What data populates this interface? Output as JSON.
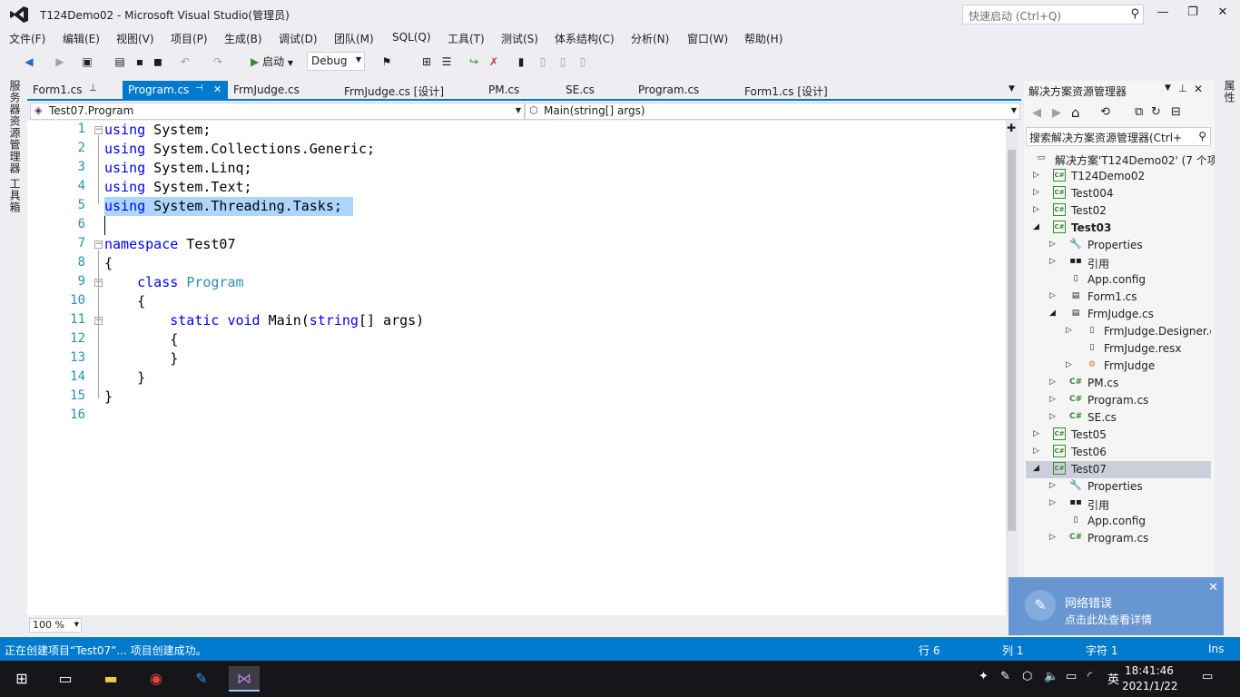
{
  "window": {
    "title": "T124Demo02 - Microsoft Visual Studio(管理员)",
    "quick_launch_placeholder": "快速启动 (Ctrl+Q)"
  },
  "menu": [
    "文件(F)",
    "编辑(E)",
    "视图(V)",
    "项目(P)",
    "生成(B)",
    "调试(D)",
    "团队(M)",
    "SQL(Q)",
    "工具(T)",
    "测试(S)",
    "体系结构(C)",
    "分析(N)",
    "窗口(W)",
    "帮助(H)"
  ],
  "toolbar": {
    "start_label": "启动",
    "config_value": "Debug"
  },
  "left_strip": {
    "server_explorer": "服务器资源管理器",
    "toolbox": "工具箱"
  },
  "right_strip": {
    "label": "属性"
  },
  "tabs": [
    "Form1.cs",
    "Program.cs",
    "FrmJudge.cs",
    "FrmJudge.cs [设计]",
    "PM.cs",
    "SE.cs",
    "Program.cs",
    "Form1.cs [设计]"
  ],
  "navbar": {
    "class_selector": "Test07.Program",
    "member_selector": "Main(string[] args)"
  },
  "editor": {
    "line_numbers": [
      "1",
      "2",
      "3",
      "4",
      "5",
      "6",
      "7",
      "8",
      "9",
      "10",
      "11",
      "12",
      "13",
      "14",
      "15",
      "16"
    ],
    "zoom": "100 %"
  },
  "solution_explorer": {
    "title": "解决方案资源管理器",
    "search_placeholder": "搜索解决方案资源管理器(Ctrl+",
    "solution": "解决方案'T124Demo02' (7 个项",
    "items": [
      "T124Demo02",
      "Test004",
      "Test02",
      "Test03",
      "Properties",
      "引用",
      "App.config",
      "Form1.cs",
      "FrmJudge.cs",
      "FrmJudge.Designer.c",
      "FrmJudge.resx",
      "FrmJudge",
      "PM.cs",
      "Program.cs",
      "SE.cs",
      "Test05",
      "Test06",
      "Test07",
      "Properties",
      "引用",
      "App.config",
      "Program.cs"
    ]
  },
  "notification": {
    "title": "网络错误",
    "body": "点击此处查看详情"
  },
  "statusbar": {
    "message": "正在创建项目“Test07”... 项目创建成功。",
    "row": "行 6",
    "col": "列 1",
    "char": "字符 1",
    "mode": "Ins"
  },
  "taskbar": {
    "time": "18:41:46",
    "date": "2021/1/22",
    "ime": "英"
  },
  "colors": {
    "accent": "#007acc",
    "keyword": "#0000ff",
    "type": "#2b91af",
    "selection": "#add6ff"
  }
}
